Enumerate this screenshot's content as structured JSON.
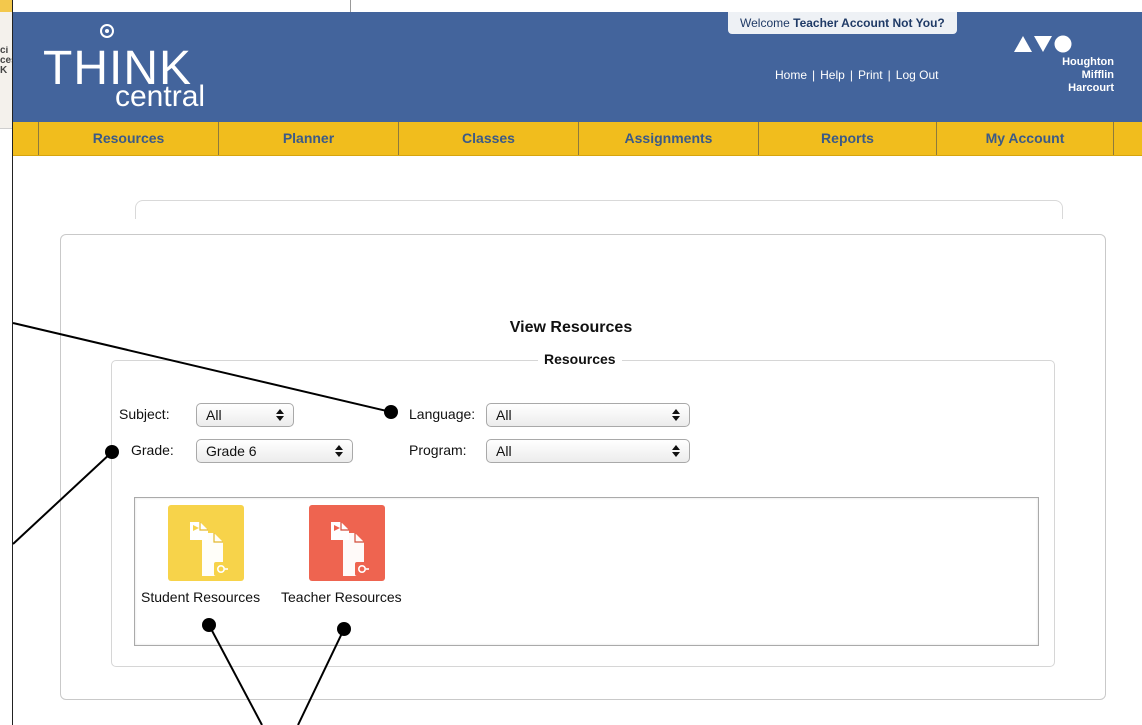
{
  "left_strip": {
    "crop_text": [
      "ci",
      "ces",
      "K"
    ]
  },
  "header": {
    "logo": {
      "think": "THINK",
      "central": "central"
    },
    "welcome": {
      "prefix": "Welcome ",
      "user": "Teacher Account",
      "not_you": "Not You?"
    },
    "links": [
      "Home",
      "Help",
      "Print",
      "Log Out"
    ],
    "link_separator": "|",
    "publisher": [
      "Houghton",
      "Mifflin",
      "Harcourt"
    ]
  },
  "mainnav": {
    "items": [
      "Resources",
      "Planner",
      "Classes",
      "Assignments",
      "Reports",
      "My Account"
    ]
  },
  "page": {
    "title": "View Resources",
    "legend": "Resources"
  },
  "filters": {
    "subject": {
      "label": "Subject:",
      "value": "All"
    },
    "language": {
      "label": "Language:",
      "value": "All"
    },
    "grade": {
      "label": "Grade:",
      "value": "Grade 6"
    },
    "program": {
      "label": "Program:",
      "value": "All"
    }
  },
  "resources": [
    {
      "label": "Student Resources",
      "color": "#f7d34a"
    },
    {
      "label": "Teacher Resources",
      "color": "#ee6450"
    }
  ],
  "colors": {
    "header_blue": "#43649c",
    "nav_yellow": "#f1bd1d",
    "nav_text": "#3b5a88"
  }
}
